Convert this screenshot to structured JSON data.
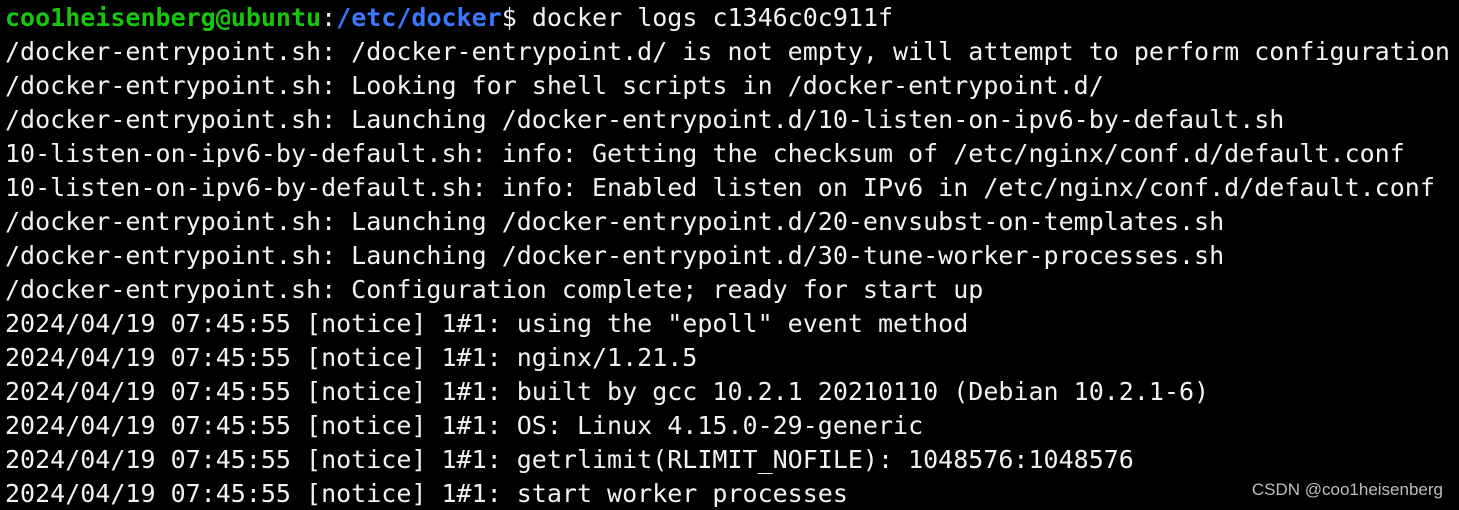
{
  "colors": {
    "background": "#000000",
    "text": "#f2f2f2",
    "prompt_user": "#16c60c",
    "prompt_path": "#3b78ff"
  },
  "prompt": {
    "user_host": "coo1heisenberg@ubuntu",
    "separator": ":",
    "path": "/etc/docker",
    "symbol": "$",
    "command": " docker logs c1346c0c911f"
  },
  "output": [
    "/docker-entrypoint.sh: /docker-entrypoint.d/ is not empty, will attempt to perform configuration",
    "/docker-entrypoint.sh: Looking for shell scripts in /docker-entrypoint.d/",
    "/docker-entrypoint.sh: Launching /docker-entrypoint.d/10-listen-on-ipv6-by-default.sh",
    "10-listen-on-ipv6-by-default.sh: info: Getting the checksum of /etc/nginx/conf.d/default.conf",
    "10-listen-on-ipv6-by-default.sh: info: Enabled listen on IPv6 in /etc/nginx/conf.d/default.conf",
    "/docker-entrypoint.sh: Launching /docker-entrypoint.d/20-envsubst-on-templates.sh",
    "/docker-entrypoint.sh: Launching /docker-entrypoint.d/30-tune-worker-processes.sh",
    "/docker-entrypoint.sh: Configuration complete; ready for start up",
    "2024/04/19 07:45:55 [notice] 1#1: using the \"epoll\" event method",
    "2024/04/19 07:45:55 [notice] 1#1: nginx/1.21.5",
    "2024/04/19 07:45:55 [notice] 1#1: built by gcc 10.2.1 20210110 (Debian 10.2.1-6)",
    "2024/04/19 07:45:55 [notice] 1#1: OS: Linux 4.15.0-29-generic",
    "2024/04/19 07:45:55 [notice] 1#1: getrlimit(RLIMIT_NOFILE): 1048576:1048576",
    "2024/04/19 07:45:55 [notice] 1#1: start worker processes"
  ],
  "watermark": "CSDN @coo1heisenberg"
}
